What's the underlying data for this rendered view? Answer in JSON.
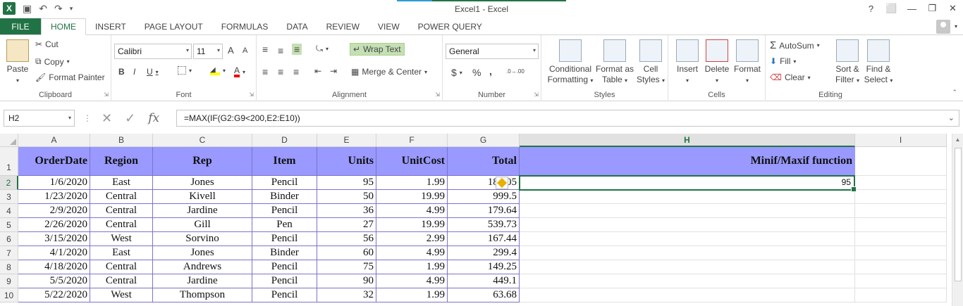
{
  "window": {
    "title": "Excel1 - Excel",
    "help": "?",
    "controls": [
      "⬜",
      "—",
      "❐",
      "✕"
    ]
  },
  "qat": {
    "undo": "↶",
    "redo": "↷",
    "save": "💾"
  },
  "tabs": [
    {
      "label": "FILE"
    },
    {
      "label": "HOME"
    },
    {
      "label": "INSERT"
    },
    {
      "label": "PAGE LAYOUT"
    },
    {
      "label": "FORMULAS"
    },
    {
      "label": "DATA"
    },
    {
      "label": "REVIEW"
    },
    {
      "label": "VIEW"
    },
    {
      "label": "POWER QUERY"
    }
  ],
  "ribbon": {
    "clipboard": {
      "paste": "Paste",
      "cut": "Cut",
      "copy": "Copy",
      "format_painter": "Format Painter",
      "label": "Clipboard"
    },
    "font": {
      "name": "Calibri",
      "size": "11",
      "bold": "B",
      "italic": "I",
      "underline": "U",
      "grow": "A",
      "shrink": "A",
      "label": "Font"
    },
    "alignment": {
      "wrap_text": "Wrap Text",
      "merge_center": "Merge & Center",
      "label": "Alignment"
    },
    "number": {
      "format": "General",
      "currency": "$",
      "percent": "%",
      "comma": ",",
      "inc": ".0→.00",
      "dec": ".00→.0",
      "label": "Number"
    },
    "styles": {
      "conditional_1": "Conditional",
      "conditional_2": "Formatting",
      "format_table_1": "Format as",
      "format_table_2": "Table",
      "cell_styles_1": "Cell",
      "cell_styles_2": "Styles",
      "label": "Styles"
    },
    "cells": {
      "insert": "Insert",
      "delete": "Delete",
      "format": "Format",
      "label": "Cells"
    },
    "editing": {
      "autosum": "AutoSum",
      "fill": "Fill",
      "clear": "Clear",
      "sort_1": "Sort &",
      "sort_2": "Filter",
      "find_1": "Find &",
      "find_2": "Select",
      "label": "Editing"
    }
  },
  "formula_bar": {
    "name_box": "H2",
    "fx": "fx",
    "formula": "=MAX(IF(G2:G9<200,E2:E10))"
  },
  "columns": [
    "A",
    "B",
    "C",
    "D",
    "E",
    "F",
    "G",
    "H",
    "I"
  ],
  "rows": [
    "1",
    "2",
    "3",
    "4",
    "5",
    "6",
    "7",
    "8",
    "9",
    "10"
  ],
  "header_row": [
    "OrderDate",
    "Region",
    "Rep",
    "Item",
    "Units",
    "UnitCost",
    "Total"
  ],
  "h1": "Minif/Maxif function",
  "h2": "95",
  "data_rows": [
    [
      "1/6/2020",
      "East",
      "Jones",
      "Pencil",
      "95",
      "1.99",
      "189.05"
    ],
    [
      "1/23/2020",
      "Central",
      "Kivell",
      "Binder",
      "50",
      "19.99",
      "999.5"
    ],
    [
      "2/9/2020",
      "Central",
      "Jardine",
      "Pencil",
      "36",
      "4.99",
      "179.64"
    ],
    [
      "2/26/2020",
      "Central",
      "Gill",
      "Pen",
      "27",
      "19.99",
      "539.73"
    ],
    [
      "3/15/2020",
      "West",
      "Sorvino",
      "Pencil",
      "56",
      "2.99",
      "167.44"
    ],
    [
      "4/1/2020",
      "East",
      "Jones",
      "Binder",
      "60",
      "4.99",
      "299.4"
    ],
    [
      "4/18/2020",
      "Central",
      "Andrews",
      "Pencil",
      "75",
      "1.99",
      "149.25"
    ],
    [
      "5/5/2020",
      "Central",
      "Jardine",
      "Pencil",
      "90",
      "4.99",
      "449.1"
    ],
    [
      "5/22/2020",
      "West",
      "Thompson",
      "Pencil",
      "32",
      "1.99",
      "63.68"
    ]
  ]
}
